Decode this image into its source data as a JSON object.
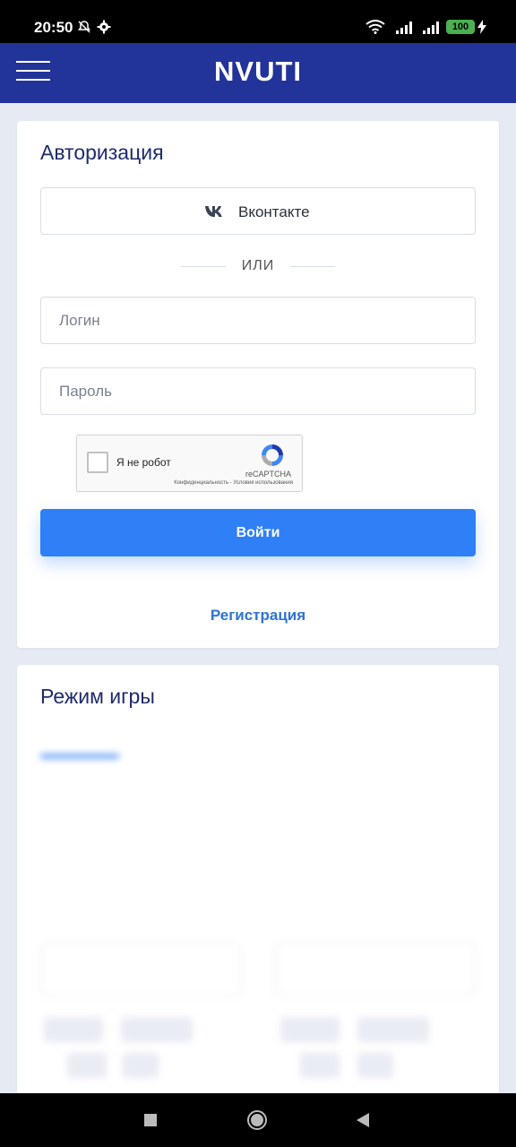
{
  "status_bar": {
    "time": "20:50",
    "battery": "100",
    "icons": [
      "bell-off-icon",
      "gear-icon",
      "wifi-icon",
      "signal-icon",
      "signal-icon",
      "battery-icon",
      "charging-icon"
    ]
  },
  "header": {
    "brand": "NVUTI",
    "menu_icon": "hamburger-icon",
    "color": "#22349a"
  },
  "auth": {
    "title": "Авторизация",
    "vk_label": "Вконтакте",
    "divider": "ИЛИ",
    "login_placeholder": "Логин",
    "password_placeholder": "Пароль",
    "captcha": {
      "label": "Я не робот",
      "brand": "reCAPTCHA",
      "terms": "Конфиденциальность - Условия использования"
    },
    "submit_label": "Войти",
    "register_label": "Регистрация",
    "accent": "#2f7ff7"
  },
  "game": {
    "title": "Режим игры"
  },
  "nav": {
    "icons": [
      "square-icon",
      "circle-icon",
      "back-icon"
    ]
  }
}
